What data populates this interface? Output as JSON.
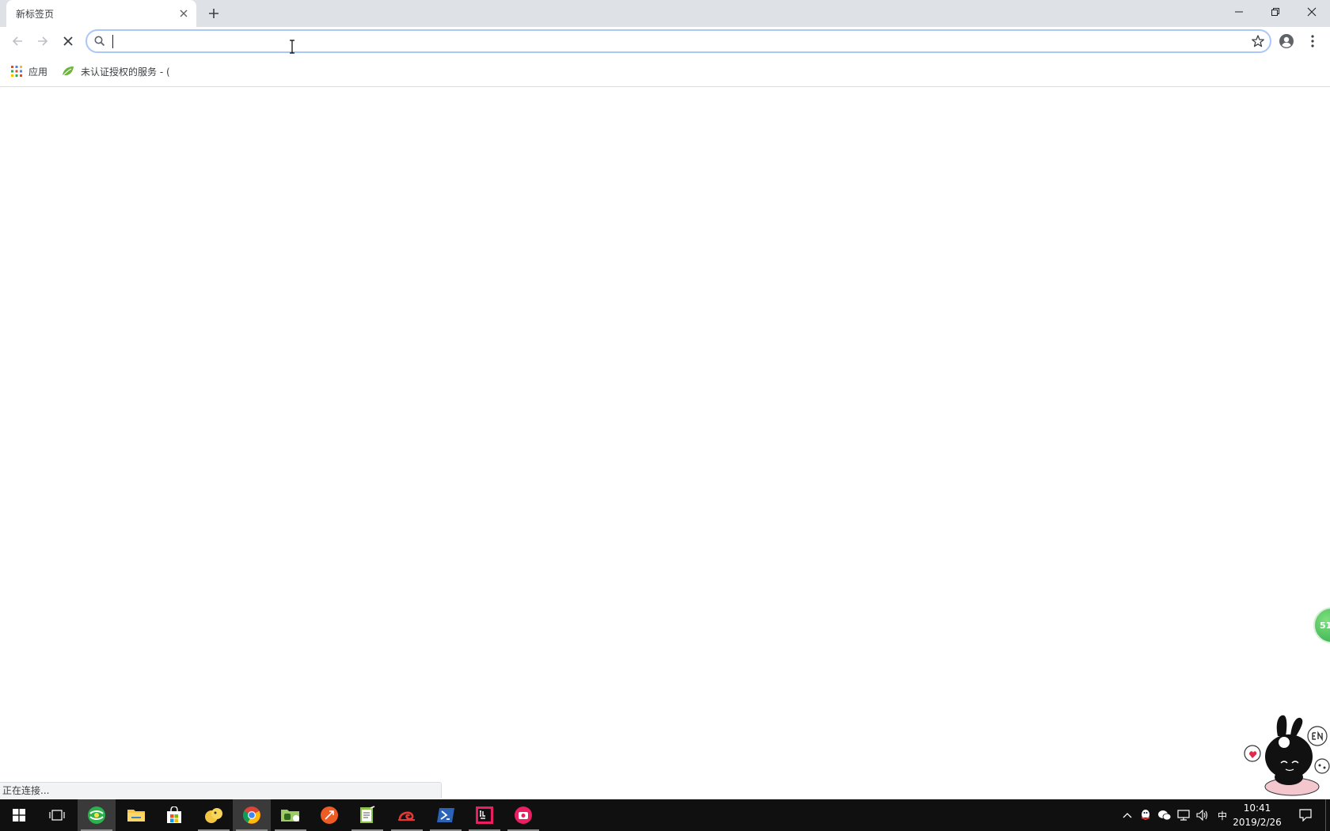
{
  "browser": {
    "tab": {
      "title": "新标签页"
    },
    "omnibox": {
      "value": "",
      "placeholder": ""
    },
    "bookmarks": [
      {
        "label": "应用",
        "icon": "apps-grid-icon"
      },
      {
        "label": "未认证授权的服务 - (",
        "icon": "leaf-icon"
      }
    ],
    "status_text": "正在连接..."
  },
  "desktop": {
    "floating_ball_text": "51"
  },
  "taskbar": {
    "ime_indicator": "中",
    "clock_time": "10:41",
    "clock_date": "2019/2/26"
  },
  "colors": {
    "tabstrip_bg": "#dee1e6",
    "omnibox_focus": "#a8c7fa",
    "taskbar_bg": "#101010",
    "chrome_active": "#3a3a3a"
  }
}
